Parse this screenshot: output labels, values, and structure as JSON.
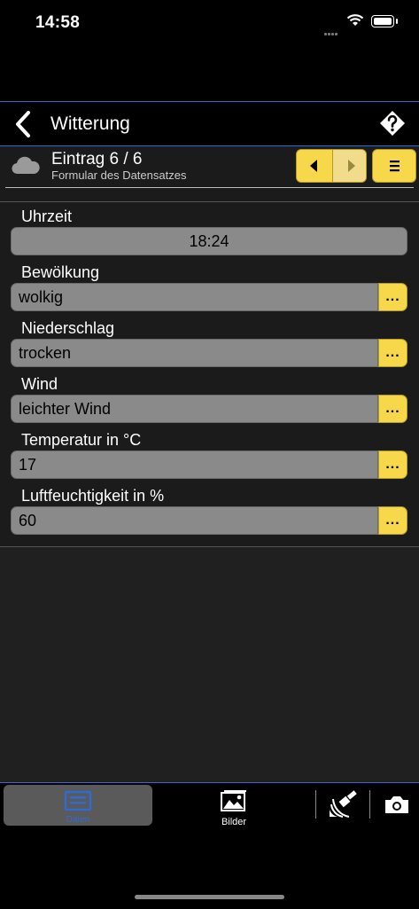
{
  "status": {
    "time": "14:58"
  },
  "navbar": {
    "title": "Witterung"
  },
  "record": {
    "entry": "Eintrag 6 / 6",
    "subtitle": "Formular des Datensatzes",
    "icon": "cloud-icon"
  },
  "fields": [
    {
      "label": "Uhrzeit",
      "value": "18:24"
    },
    {
      "label": "Bewölkung",
      "value": "wolkig",
      "button": "..."
    },
    {
      "label": "Niederschlag",
      "value": "trocken",
      "button": "..."
    },
    {
      "label": "Wind",
      "value": "leichter Wind",
      "button": "..."
    },
    {
      "label": "Temperatur in °C",
      "value": "17",
      "button": "..."
    },
    {
      "label": "Luftfeuchtigkeit in %",
      "value": "60",
      "button": "..."
    }
  ],
  "tabs": {
    "active_label": "Daten",
    "bilder_label": "Bilder"
  },
  "colors": {
    "accent": "#f7d84a",
    "blue": "#2f6bd4",
    "field": "#8a8a8a"
  }
}
